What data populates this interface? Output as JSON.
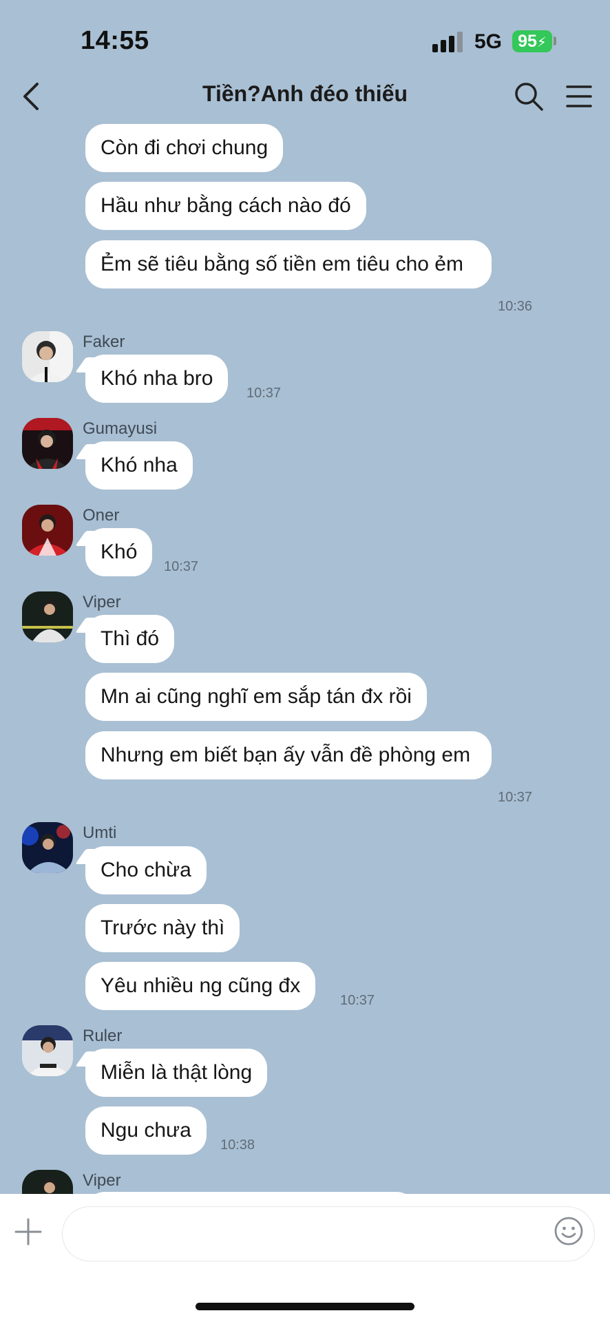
{
  "status": {
    "time": "14:55",
    "network": "5G",
    "battery": "95"
  },
  "header": {
    "title": "Tiền?Anh đéo thiếu"
  },
  "messages": {
    "m1": "Còn đi chơi chung",
    "m2": "Hầu như bằng cách nào đó",
    "m3": "Ẻm sẽ tiêu bằng số tiền em tiêu cho ẻm",
    "t3": "10:36",
    "faker": {
      "name": "Faker",
      "m1": "Khó nha bro",
      "t1": "10:37"
    },
    "guma": {
      "name": "Gumayusi",
      "m1": "Khó nha"
    },
    "oner": {
      "name": "Oner",
      "m1": "Khó",
      "t1": "10:37"
    },
    "viper": {
      "name": "Viper",
      "m1": "Thì đó",
      "m2": "Mn ai cũng nghĩ em sắp tán đx rồi",
      "m3": "Nhưng em biết bạn ấy vẫn đề phòng em",
      "t3": "10:37"
    },
    "umti": {
      "name": "Umti",
      "m1": "Cho chừa",
      "m2": "Trước này thì",
      "m3": "Yêu nhiều ng cũng đx",
      "t3": "10:37"
    },
    "ruler": {
      "name": "Ruler",
      "m1": "Miễn là thật lòng",
      "m2": "Ngu chưa",
      "t2": "10:38"
    },
    "viper2": {
      "name": "Viper"
    }
  },
  "icons": {
    "back": "chevron-left-icon",
    "search": "search-icon",
    "menu": "hamburger-menu-icon",
    "plus": "plus-icon",
    "emoji": "smiley-icon"
  },
  "colors": {
    "background": "#a9bfd3",
    "bubble": "#ffffff",
    "battery": "#34c759"
  }
}
